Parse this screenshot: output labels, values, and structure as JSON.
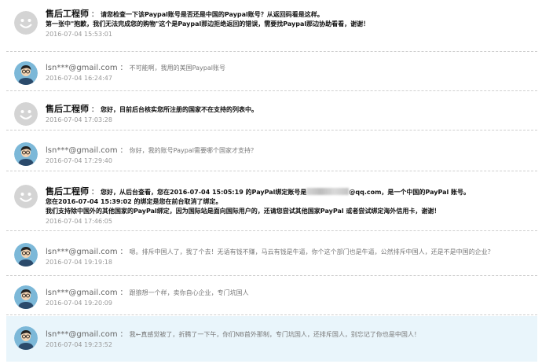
{
  "messages": [
    {
      "sender": "售后工程师",
      "lines": [
        "请您检查一下该Paypal账号是否还是中国的Paypal账号？从返回码看是这样。",
        "第一张中\"抱歉，我们无法完成您的购物\"这个是Paypal那边拒绝返回的错误，需要找Paypal那边协助看看，谢谢！"
      ],
      "time": "2016-07-04 15:53:01"
    },
    {
      "sender": "lsn***@gmail.com",
      "text": "不可能啊，我用的美国Paypal账号",
      "time": "2016-07-04 16:24:47"
    },
    {
      "sender": "售后工程师",
      "lines": [
        "您好，目前后台核实您所注册的国家不在支持的列表中。"
      ],
      "time": "2016-07-04 17:03:28"
    },
    {
      "sender": "lsn***@gmail.com",
      "text": "你好，我的账号Paypal需要哪个国家才支持？",
      "time": "2016-07-04 17:29:40"
    },
    {
      "sender": "售后工程师",
      "line1_before": "您好，从后台查看，您在2016-07-04 15:05:19 的PayPal绑定账号是",
      "line1_after": "@qq.com，是一个中国的PayPal 账号。",
      "lines_rest": [
        "您在2016-07-04 15:39:02 的绑定是您在前台取消了绑定。",
        "我们支持除中国外的其他国家的PayPal绑定，因为国际站是面向国际用户的，还请您尝试其他国家PayPal 或者尝试绑定海外信用卡，谢谢！"
      ],
      "time": "2016-07-04 17:46:05"
    },
    {
      "sender": "lsn***@gmail.com",
      "text": "嗯。排斥中国人了，我了个去！无语有钱不赚，马云有钱是牛逼，你个这个部门也是牛逼，公然排斥中国人，还是不是中国的企业？",
      "time": "2016-07-04 19:19:18"
    },
    {
      "sender": "lsn***@gmail.com",
      "text": "跟狼想一个样，卖你自心企业，专门坑国人",
      "time": "2016-07-04 19:20:09"
    },
    {
      "sender": "lsn***@gmail.com",
      "text": "我←真感觉被了，折腾了一下午，你们NB首外那制，专门坑国人，还排斥国人，别忘记了你也是中国人！",
      "time": "2016-07-04 19:23:52"
    }
  ],
  "separator": "：",
  "colors": {
    "highlight_bg": "#e9f5fb",
    "engineer_avatar": "#d4d4d4",
    "user_avatar_bg": "#7cb8d8"
  },
  "icons": {
    "engineer": "smiley-avatar-icon",
    "user": "person-with-glasses-avatar-icon"
  }
}
